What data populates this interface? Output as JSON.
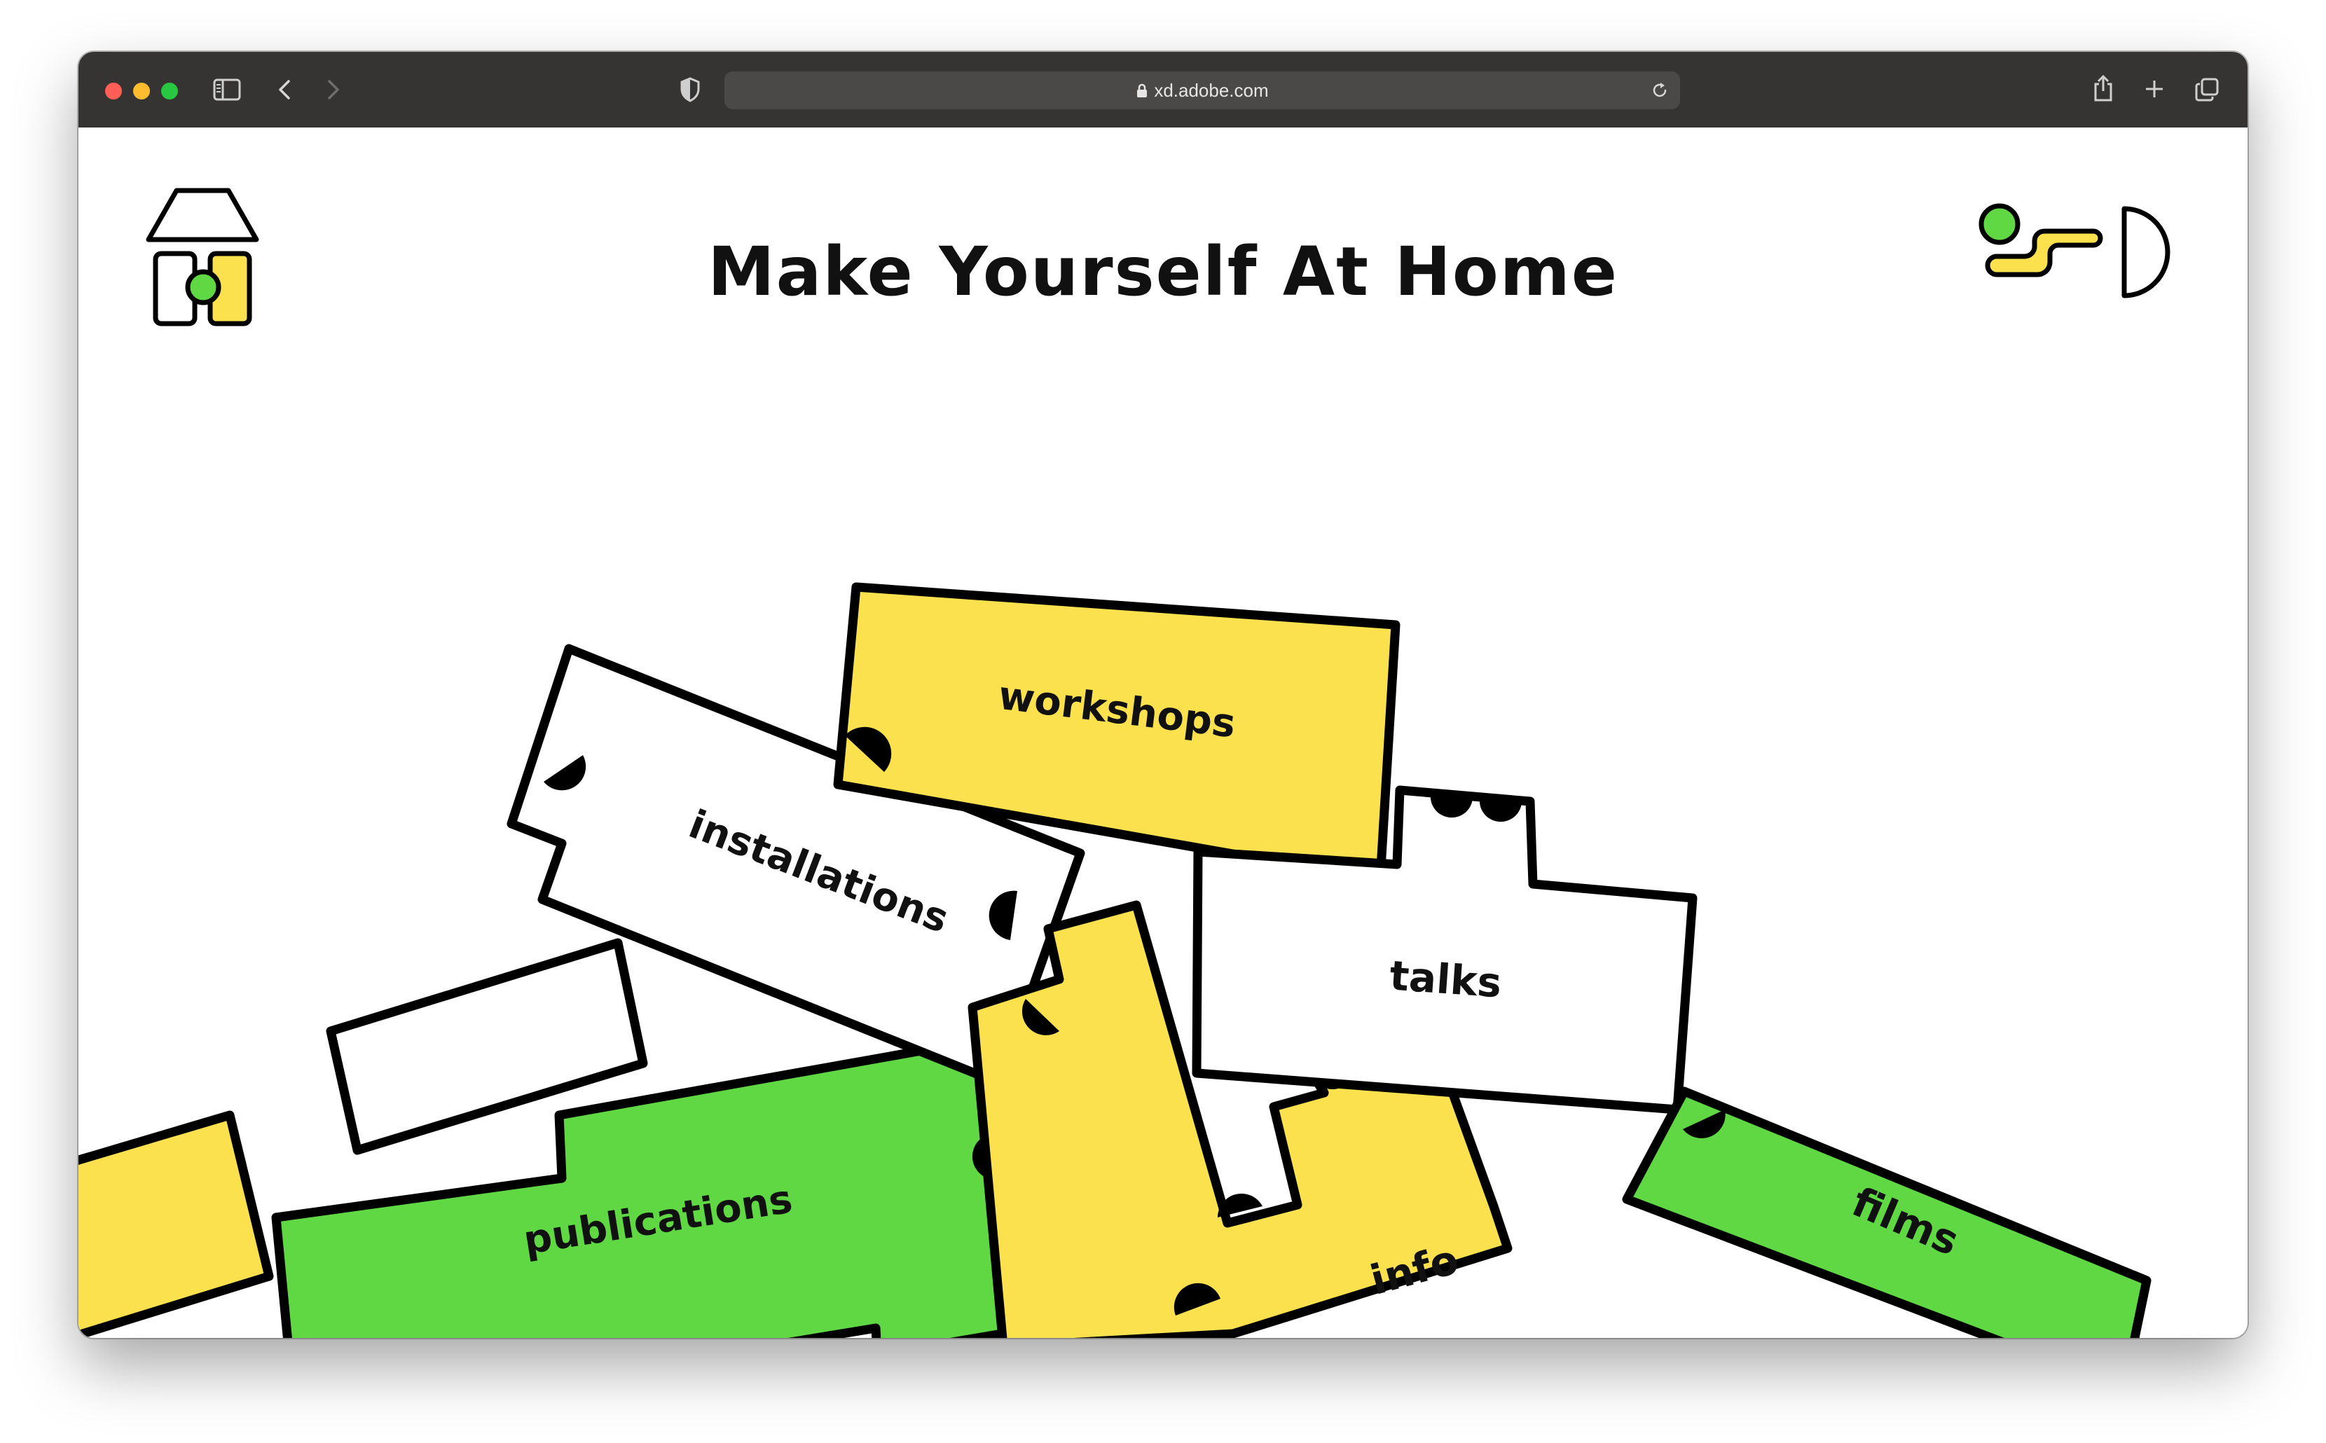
{
  "browser": {
    "url": "xd.adobe.com",
    "icons": [
      "sidebar-icon",
      "back-icon",
      "forward-icon",
      "shield-icon",
      "lock-icon",
      "reload-icon",
      "share-icon",
      "new-tab-icon",
      "tabs-overview-icon"
    ]
  },
  "page": {
    "title": "Make Yourself At Home"
  },
  "nav": {
    "workshops": "workshops",
    "installations": "installations",
    "talks": "talks",
    "publications": "publications",
    "info": "info",
    "films": "films"
  },
  "colors": {
    "yellow": "#fbe14e",
    "green": "#5fd843",
    "outline": "#000000",
    "titlebar": "#353433"
  }
}
